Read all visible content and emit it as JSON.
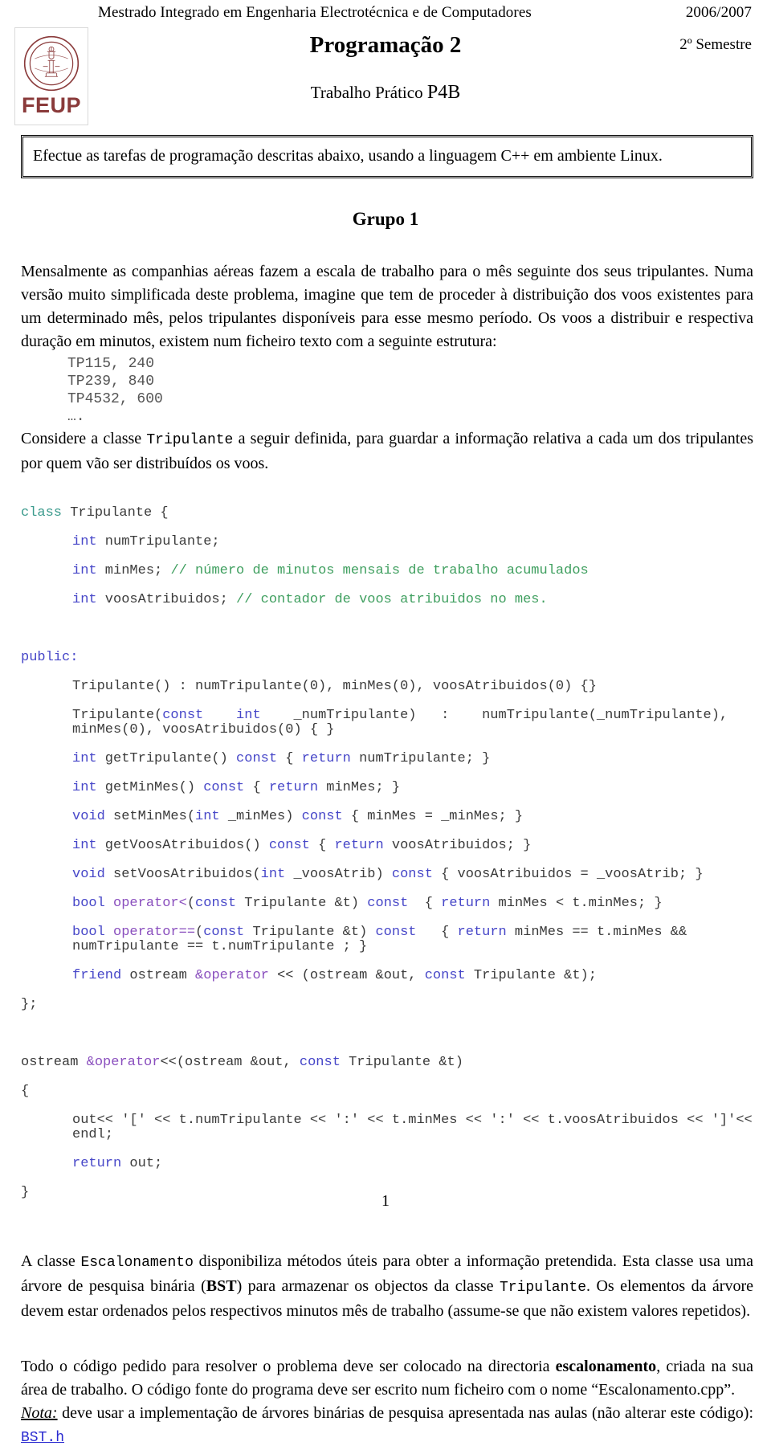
{
  "header": {
    "course": "Mestrado Integrado em Engenharia Electrotécnica e de Computadores",
    "year": "2006/2007"
  },
  "title": {
    "course_title": "Programação 2",
    "semester": "2º Semestre",
    "assignment_label": "Trabalho Prático",
    "assignment_code": "P4B",
    "logo_word": "FEUP",
    "logo_color": "#8a3a3a"
  },
  "instruction": {
    "text": "Efectue as tarefas de programação descritas abaixo, usando a linguagem C++ em ambiente Linux."
  },
  "group": {
    "heading": "Grupo 1",
    "intro_p1": "Mensalmente as companhias aéreas fazem a escala de trabalho para o mês seguinte dos seus tripulantes. Numa versão muito simplificada deste problema, imagine que tem de proceder à distribuição dos voos existentes para um determinado mês, pelos tripulantes disponíveis para esse mesmo período. Os voos a distribuir e respectiva duração em minutos, existem num ficheiro texto com a seguinte estrutura:",
    "file_sample": [
      "TP115, 240",
      "TP239, 840",
      "TP4532, 600",
      "…."
    ],
    "intro_p2_a": "Considere a classe ",
    "intro_p2_class": "Tripulante",
    "intro_p2_b": " a seguir definida, para guardar a informação relativa a cada um dos tripulantes por quem vão ser distribuídos os voos."
  },
  "code": {
    "l01_kw": "class",
    "l01_rest": " Tripulante {",
    "l02_kw": "int",
    "l02_rest": " numTripulante;",
    "l03_kw": "int",
    "l03_rest": " minMes; ",
    "l03_cmt": "// número de minutos mensais de trabalho acumulados",
    "l04_kw": "int",
    "l04_rest": " voosAtribuidos; ",
    "l04_cmt": "// contador de voos atribuidos no mes.",
    "l05_blank": "",
    "l06_kw": "public:",
    "l07": "Tripulante() : numTripulante(0), minMes(0), voosAtribuidos(0) {}",
    "l08_a": "Tripulante(",
    "l08_kw1": "const",
    "l08_b": "    ",
    "l08_kw2": "int",
    "l08_c": "    _numTripulante)   :    numTripulante(_numTripulante),   minMes(0), voosAtribuidos(0) { }",
    "l09_kw1": "int",
    "l09_a": " getTripulante() ",
    "l09_kw2": "const",
    "l09_b": " { ",
    "l09_kw3": "return",
    "l09_c": " numTripulante; }",
    "l10_kw1": "int",
    "l10_a": " getMinMes() ",
    "l10_kw2": "const",
    "l10_b": " { ",
    "l10_kw3": "return",
    "l10_c": " minMes; }",
    "l11_kw1": "void",
    "l11_a": " setMinMes(",
    "l11_kw2": "int",
    "l11_b": " _minMes) ",
    "l11_kw3": "const",
    "l11_c": " { minMes = _minMes; }",
    "l12_kw1": "int",
    "l12_a": " getVoosAtribuidos() ",
    "l12_kw2": "const",
    "l12_b": " { ",
    "l12_kw3": "return",
    "l12_c": " voosAtribuidos; }",
    "l13_kw1": "void",
    "l13_a": " setVoosAtribuidos(",
    "l13_kw2": "int",
    "l13_b": " _voosAtrib) ",
    "l13_kw3": "const",
    "l13_c": " { voosAtribuidos = _voosAtrib; }",
    "l14_kw1": "bool",
    "l14_op": " operator<",
    "l14_a": "(",
    "l14_kw2": "const",
    "l14_b": " Tripulante &t) ",
    "l14_kw3": "const",
    "l14_c": "  { ",
    "l14_kw4": "return",
    "l14_d": " minMes < t.minMes; }",
    "l15_kw1": "bool",
    "l15_op": " operator==",
    "l15_a": "(",
    "l15_kw2": "const",
    "l15_b": " Tripulante &t) ",
    "l15_kw3": "const",
    "l15_c": "   { ",
    "l15_kw4": "return",
    "l15_d": " minMes == t.minMes && numTripulante == t.numTripulante ; }",
    "l16_kw": "friend",
    "l16_a": " ostream ",
    "l16_op": "&operator",
    "l16_b": " << (ostream &out, ",
    "l16_kw2": "const",
    "l16_c": " Tripulante &t);",
    "l17": "};",
    "l18_blank": "",
    "l19_a": "ostream ",
    "l19_op": "&operator",
    "l19_b": "<<(ostream &out, ",
    "l19_kw": "const",
    "l19_c": " Tripulante &t)",
    "l20": "{",
    "l21": "out<< '[' << t.numTripulante << ':' << t.minMes << ':' << t.voosAtribuidos << ']'<< endl;",
    "l22_kw": "return",
    "l22_a": " out;",
    "l23": "}"
  },
  "escalonamento": {
    "p_a": "A classe ",
    "p_class1": "Escalonamento",
    "p_b": " disponibiliza métodos úteis para obter a informação pretendida. Esta classe usa uma árvore de pesquisa binária (",
    "p_bst": "BST",
    "p_c": ") para armazenar os objectos da classe ",
    "p_class2": "Tripulante",
    "p_d": ". Os elementos da árvore devem estar ordenados pelos respectivos minutos mês de trabalho (assume-se que não existem valores repetidos)."
  },
  "footer_text": {
    "p_a": "Todo o código pedido para resolver o problema deve ser colocado na directoria ",
    "p_dir": "escalonamento",
    "p_b": ", criada na sua área de trabalho. O código fonte do programa deve ser escrito num ficheiro com o nome “Escalonamento.cpp”.",
    "note_label": "Nota:",
    "note_text": " deve usar a implementação de árvores binárias de pesquisa apresentada nas aulas (não alterar este código): ",
    "note_link": "BST.h"
  },
  "page_number": "1"
}
